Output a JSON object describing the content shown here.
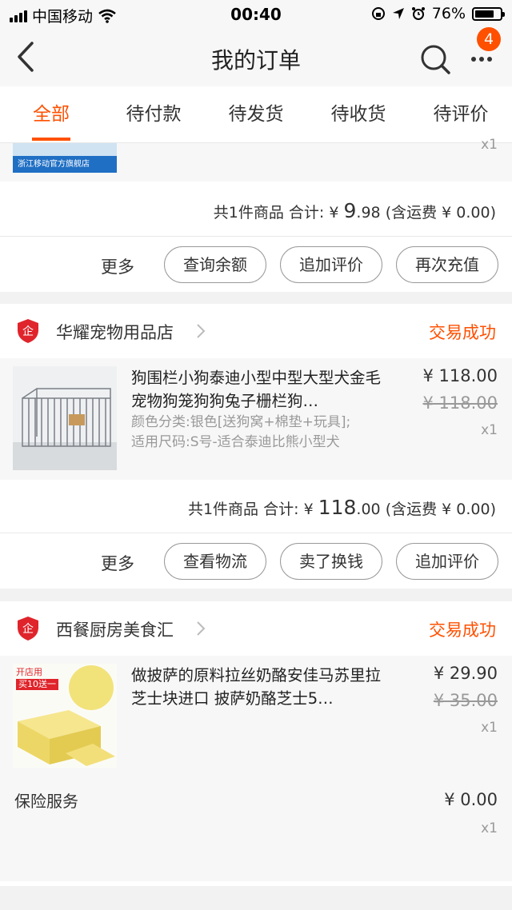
{
  "status_bar": {
    "carrier": "中国移动",
    "time": "00:40",
    "battery": "76%",
    "battery_level": 0.76
  },
  "nav": {
    "title": "我的订单",
    "badge": "4"
  },
  "tabs": [
    "全部",
    "待付款",
    "待发货",
    "待收货",
    "待评价"
  ],
  "order1": {
    "store_banner": "浙江移动官方旗舰店",
    "qty_partial": "x1",
    "summary": {
      "count": "共1件商品",
      "total_label": "合计:",
      "currency": "¥",
      "int": "9",
      "dec": ".98",
      "shipping": "(含运费 ¥ 0.00)"
    },
    "more": "更多",
    "buttons": [
      "查询余额",
      "追加评价",
      "再次充值"
    ]
  },
  "order2": {
    "shop": "华耀宠物用品店",
    "status": "交易成功",
    "title": "狗围栏小狗泰迪小型中型大型犬金毛宠物狗笼狗狗兔子栅栏狗…",
    "attr1": "颜色分类:银色[送狗窝+棉垫+玩具];",
    "attr2": "适用尺码:S号-适合泰迪比熊小型犬",
    "price": "¥ 118.00",
    "original_price": "¥ 118.00",
    "qty": "x1",
    "summary": {
      "count": "共1件商品",
      "total_label": "合计:",
      "currency": "¥",
      "int": "118",
      "dec": ".00",
      "shipping": "(含运费 ¥ 0.00)"
    },
    "more": "更多",
    "buttons": [
      "查看物流",
      "卖了换钱",
      "追加评价"
    ]
  },
  "order3": {
    "shop": "西餐厨房美食汇",
    "status": "交易成功",
    "title": "做披萨的原料拉丝奶酪安佳马苏里拉芝士块进口 披萨奶酪芝士5…",
    "price": "¥ 29.90",
    "original_price": "¥ 35.00",
    "qty": "x1",
    "thumb_tag1": "开店用",
    "thumb_tag2": "买10送一",
    "insurance": {
      "label": "保险服务",
      "price": "¥ 0.00",
      "qty": "x1"
    }
  },
  "colors": {
    "accent": "#ff5000",
    "bg": "#f2f2f2",
    "item_bg": "#f7f7f7"
  },
  "icons": [
    "back-chevron-icon",
    "search-icon",
    "more-dots-icon",
    "shop-badge-icon",
    "chevron-right-icon"
  ]
}
